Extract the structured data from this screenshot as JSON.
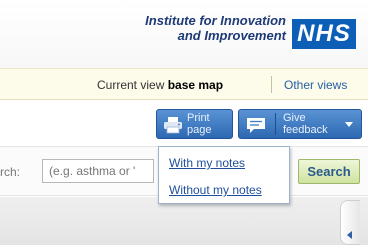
{
  "header": {
    "institute_line1": "Institute for Innovation",
    "institute_line2": "and Improvement",
    "logo_text": "NHS",
    "logo_color": "#0d5eb7"
  },
  "viewbar": {
    "current_view_prefix": "Current view",
    "current_view_value": "base map",
    "other_views_label": "Other views"
  },
  "toolbar": {
    "print_label_line1": "Print",
    "print_label_line2": "page",
    "print_icon": "printer-icon",
    "feedback_label_line1": "Give",
    "feedback_label_line2": "feedback",
    "feedback_icon": "speech-bubble-icon",
    "button_color": "#3f7cc4"
  },
  "print_menu": {
    "items": [
      {
        "label": "With my notes"
      },
      {
        "label": "Without my notes"
      }
    ]
  },
  "search": {
    "label_partial": "rch:",
    "placeholder": "(e.g. asthma or '",
    "button_label": "Search",
    "button_color": "#cfe3a0"
  }
}
